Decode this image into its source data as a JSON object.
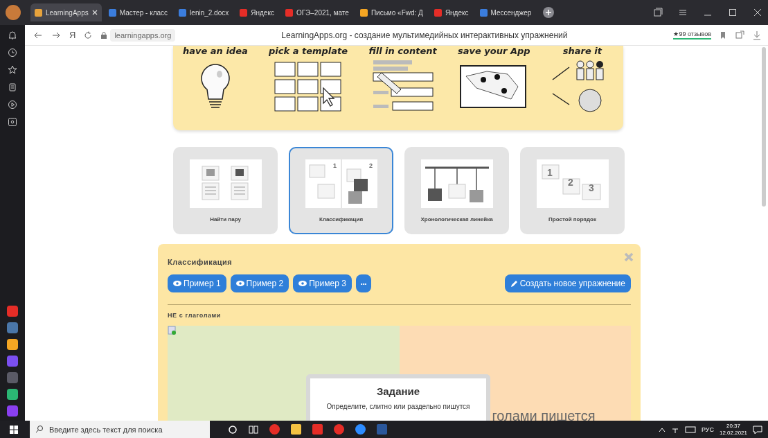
{
  "tabs": [
    {
      "label": "LearningApps",
      "selected": true
    },
    {
      "label": "Мастер - класс",
      "selected": false
    },
    {
      "label": "lenin_2.docx",
      "selected": false
    },
    {
      "label": "Яндекс",
      "selected": false
    },
    {
      "label": "ОГЭ–2021, мате",
      "selected": false
    },
    {
      "label": "Письмо «Fwd: Д",
      "selected": false
    },
    {
      "label": "Яндекс",
      "selected": false
    },
    {
      "label": "Мессенджер",
      "selected": false
    }
  ],
  "address_bar": {
    "yandex_key": "Я",
    "url": "learningapps.org",
    "page_title": "LearningApps.org - создание мультимедийных интерактивных упражнений",
    "reviews": "★99 отзывов"
  },
  "sidebar": {
    "apps": [
      {
        "color": "#e52d27"
      },
      {
        "color": "#4a76a8"
      },
      {
        "color": "#f5a623"
      },
      {
        "color": "#7b4ff0"
      },
      {
        "color": "#5a5a66"
      },
      {
        "color": "#2bb673"
      },
      {
        "color": "#8a3ff0"
      }
    ]
  },
  "steps": [
    "have an idea",
    "pick a template",
    "fill in content",
    "save your App",
    "share it"
  ],
  "templates": [
    {
      "label": "Найти пару",
      "selected": false
    },
    {
      "label": "Классификация",
      "selected": true,
      "numbers": [
        "1",
        "2"
      ]
    },
    {
      "label": "Хронологическая линейка",
      "selected": false
    },
    {
      "label": "Простой порядок",
      "selected": false,
      "numbers": [
        "1",
        "2",
        "3"
      ]
    }
  ],
  "panel": {
    "title": "Классификация",
    "examples": [
      "Пример 1",
      "Пример 2",
      "Пример 3"
    ],
    "more": "•••",
    "create": "Создать новое упражнение",
    "exercise_title": "НЕ с глаголами",
    "right_text": "голами пишется",
    "task": {
      "title": "Задание",
      "text": "Определите, слитно или раздельно пишутся"
    }
  },
  "taskbar": {
    "search_placeholder": "Введите здесь текст для поиска",
    "language": "РУС",
    "time": "20:37",
    "date": "12.02.2021"
  }
}
